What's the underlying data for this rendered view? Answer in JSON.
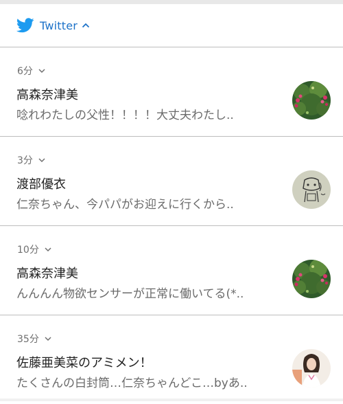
{
  "header": {
    "app_name": "Twitter",
    "icon": "twitter-bird-icon",
    "brand_color": "#1d9bf0",
    "expand_icon": "chevron-up-icon"
  },
  "notifications": [
    {
      "time": "6分",
      "sender": "高森奈津美",
      "message": "唸れわたしの父性！！！！大丈夫わたし..",
      "avatar": "flower-bush-avatar"
    },
    {
      "time": "3分",
      "sender": "渡部優衣",
      "message": "仁奈ちゃん、今パパがお迎えに行くから..",
      "avatar": "sketch-drawing-avatar"
    },
    {
      "time": "10分",
      "sender": "高森奈津美",
      "message": "んんんん物欲センサーが正常に働いてる(*..",
      "avatar": "flower-bush-avatar"
    },
    {
      "time": "35分",
      "sender": "佐藤亜美菜のアミメン！",
      "message": "たくさんの白封筒…仁奈ちゃんどこ…byあ..",
      "avatar": "person-photo-avatar"
    }
  ]
}
